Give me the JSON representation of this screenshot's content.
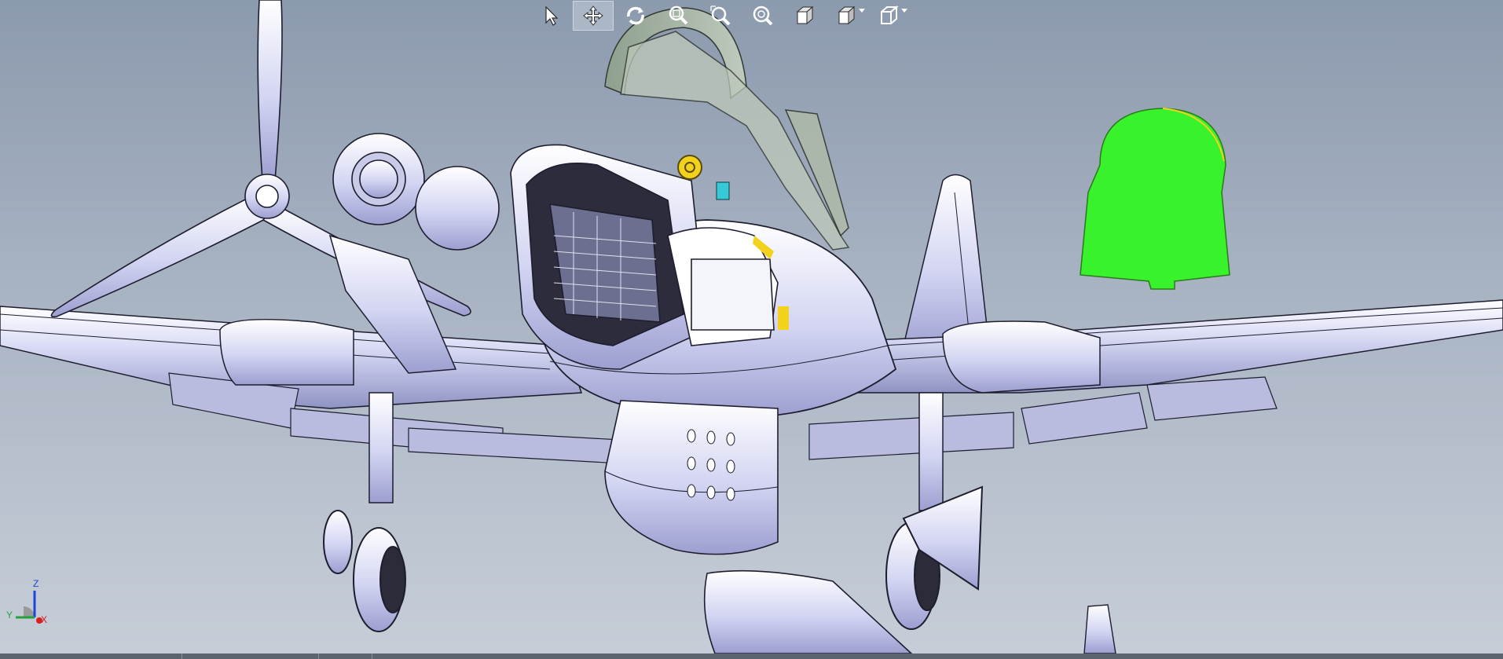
{
  "window": {
    "title": ""
  },
  "toolbar": {
    "tools": [
      {
        "id": "select",
        "icon": "select-arrow-icon",
        "active": false
      },
      {
        "id": "pan",
        "icon": "pan-move-icon",
        "active": true
      },
      {
        "id": "rotate",
        "icon": "rotate-view-icon",
        "active": false
      },
      {
        "id": "zoom-to-fit",
        "icon": "zoom-to-fit-icon",
        "active": false
      },
      {
        "id": "zoom-to-area",
        "icon": "zoom-to-area-icon",
        "active": false
      },
      {
        "id": "zoom-in-out",
        "icon": "zoom-in-out-icon",
        "active": false
      },
      {
        "id": "view-orientation",
        "icon": "cube-view-icon",
        "active": false
      },
      {
        "id": "display-style",
        "icon": "display-style-icon",
        "active": false,
        "dropdown": true
      },
      {
        "id": "section-view",
        "icon": "section-cube-icon",
        "active": false,
        "dropdown": true
      }
    ]
  },
  "triad": {
    "z_label": "Z",
    "y_label": "Y",
    "x_label": "X"
  },
  "colors": {
    "background_top": "#8c9aae",
    "background_bottom": "#c7ced8",
    "model_fill": "#d4d6f2",
    "model_edge": "#1d1d2e",
    "selected_face": "#38f22c",
    "canopy": "#a9b7a2",
    "accent_yellow": "#f2d21c",
    "accent_cyan": "#36c9d6"
  }
}
